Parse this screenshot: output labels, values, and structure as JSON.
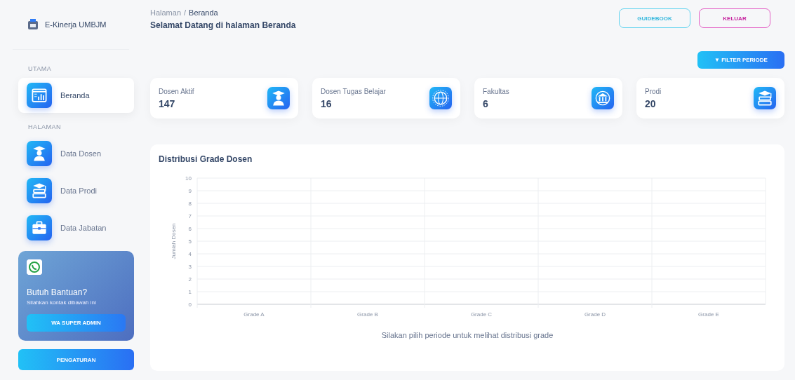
{
  "sidebar": {
    "logo_text": "E-Kinerja UMBJM",
    "sections": [
      {
        "title": "UTAMA",
        "items": [
          {
            "label": "Beranda",
            "kind": "dashboard",
            "selected": true
          }
        ]
      },
      {
        "title": "HALAMAN",
        "items": [
          {
            "label": "Data Dosen",
            "kind": "graduate",
            "selected": false
          },
          {
            "label": "Data Prodi",
            "kind": "books",
            "selected": false
          },
          {
            "label": "Data Jabatan",
            "kind": "briefcase",
            "selected": false
          }
        ]
      }
    ],
    "help": {
      "title": "Butuh Bantuan?",
      "text": "Silahkan kontak dibawah ini",
      "button": "WA SUPER ADMIN"
    },
    "settings_button": "PENGATURAN"
  },
  "header": {
    "breadcrumb": [
      "Halaman",
      "/",
      "Beranda"
    ],
    "title": "Selamat Datang di halaman Beranda",
    "buttons": [
      {
        "label": "GUIDEBOOK",
        "kind": "info"
      },
      {
        "label": "KELUAR",
        "kind": "danger"
      }
    ]
  },
  "filter_button": {
    "icon": "▼",
    "label": "FILTER PERIODE"
  },
  "stats": [
    {
      "label": "Dosen Aktif",
      "value": "147",
      "kind": "graduate"
    },
    {
      "label": "Dosen Tugas Belajar",
      "value": "16",
      "kind": "globe"
    },
    {
      "label": "Fakultas",
      "value": "6",
      "kind": "building"
    },
    {
      "label": "Prodi",
      "value": "20",
      "kind": "books"
    }
  ],
  "chart_card": {
    "title": "Distribusi Grade Dosen",
    "message": "Silakan pilih periode untuk melihat distribusi grade",
    "chart_data": {
      "type": "bar",
      "grid": true,
      "ylabel": "Jumlah Dosen",
      "categories": [
        "Grade A",
        "Grade B",
        "Grade C",
        "Grade D",
        "Grade E"
      ],
      "values": [
        null,
        null,
        null,
        null,
        null
      ],
      "ylim": [
        0,
        10
      ],
      "yticks": [
        0,
        1,
        2,
        3,
        4,
        5,
        6,
        7,
        8,
        9,
        10
      ]
    }
  }
}
